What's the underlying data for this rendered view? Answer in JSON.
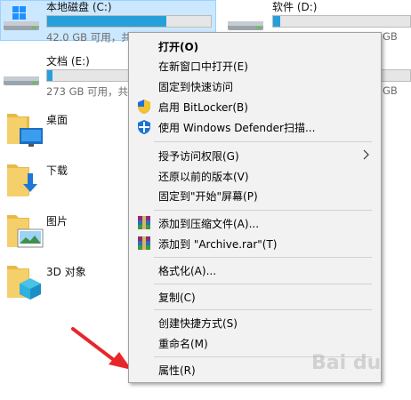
{
  "drives": [
    {
      "name": "本地磁盘 (C:)",
      "info": "42.0 GB 可用，共",
      "fill": 0.73
    },
    {
      "name": "软件 (D:)",
      "info": "GB",
      "fill": 0.05
    },
    {
      "name": "文档 (E:)",
      "info": "273 GB 可用，共",
      "fill": 0.03
    },
    {
      "name": "",
      "info": "GB",
      "fill": 0.05
    }
  ],
  "folders": [
    {
      "name": "桌面",
      "icon": "desktop-folder-icon"
    },
    {
      "name": "下载",
      "icon": "downloads-folder-icon"
    },
    {
      "name": "图片",
      "icon": "pictures-folder-icon"
    },
    {
      "name": "3D 对象",
      "icon": "3d-objects-folder-icon"
    }
  ],
  "context_menu": {
    "open": "打开(O)",
    "open_new_window": "在新窗口中打开(E)",
    "pin_quick_access": "固定到快速访问",
    "bitlocker": "启用 BitLocker(B)",
    "defender": "使用 Windows Defender扫描...",
    "give_access": "授予访问权限(G)",
    "restore_versions": "还原以前的版本(V)",
    "pin_start": "固定到\"开始\"屏幕(P)",
    "add_archive": "添加到压缩文件(A)...",
    "add_archive_rar": "添加到 \"Archive.rar\"(T)",
    "format": "格式化(A)...",
    "copy": "复制(C)",
    "create_shortcut": "创建快捷方式(S)",
    "rename": "重命名(M)",
    "properties": "属性(R)"
  },
  "colors": {
    "selection": "#cce8ff",
    "bar_fill": "#26a0da",
    "arrow": "#e8262a"
  },
  "watermark": "Bai du"
}
